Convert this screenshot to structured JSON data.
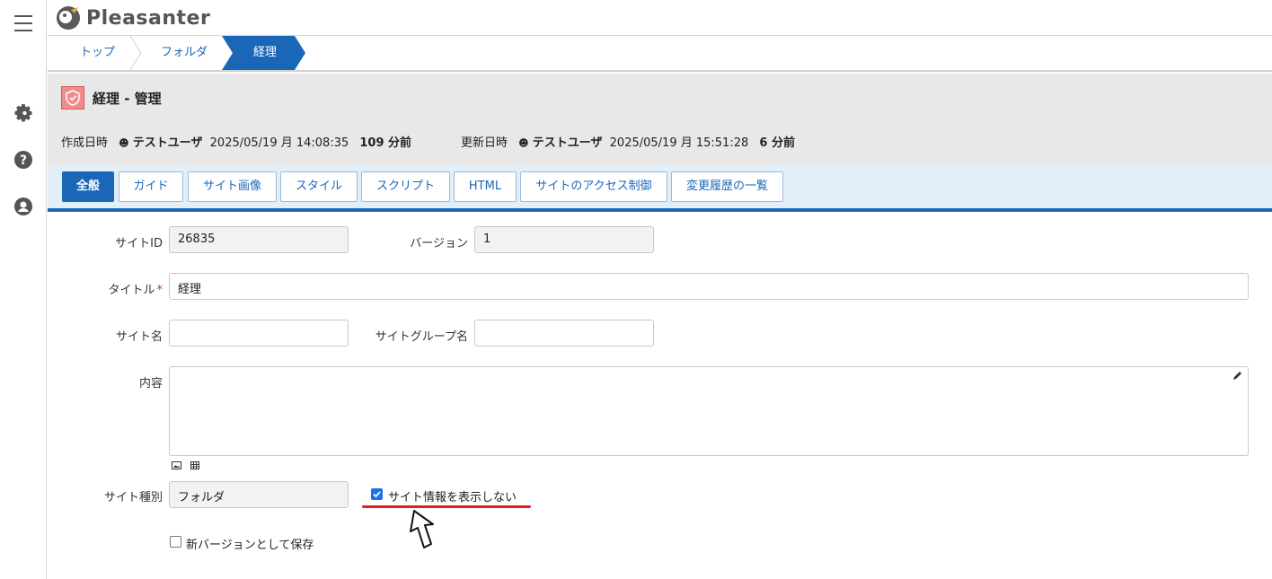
{
  "app": {
    "logo_text": "Pleasanter"
  },
  "rail": {
    "icons": [
      "menu-icon",
      "gear-icon",
      "help-icon",
      "user-icon"
    ]
  },
  "breadcrumb": {
    "items": [
      "トップ",
      "フォルダ",
      "経理"
    ]
  },
  "header": {
    "title": "経理 - 管理",
    "created_label": "作成日時",
    "created_user": "テストユーザ",
    "created_datetime": "2025/05/19 月 14:08:35",
    "created_ago": "109 分前",
    "updated_label": "更新日時",
    "updated_user": "テストユーザ",
    "updated_datetime": "2025/05/19 月 15:51:28",
    "updated_ago": "6 分前"
  },
  "tabs": [
    "全般",
    "ガイド",
    "サイト画像",
    "スタイル",
    "スクリプト",
    "HTML",
    "サイトのアクセス制御",
    "変更履歴の一覧"
  ],
  "form": {
    "site_id_label": "サイトID",
    "site_id_value": "26835",
    "version_label": "バージョン",
    "version_value": "1",
    "title_label": "タイトル",
    "title_required": "*",
    "title_value": "経理",
    "site_name_label": "サイト名",
    "site_name_value": "",
    "site_group_label": "サイトグループ名",
    "site_group_value": "",
    "content_label": "内容",
    "content_value": "",
    "site_type_label": "サイト種別",
    "site_type_value": "フォルダ",
    "hide_info_label": "サイト情報を表示しない",
    "hide_info_checked": true,
    "new_version_label": "新バージョンとして保存",
    "new_version_checked": false
  },
  "colors": {
    "accent": "#1a67b8",
    "highlight": "#e02020"
  }
}
